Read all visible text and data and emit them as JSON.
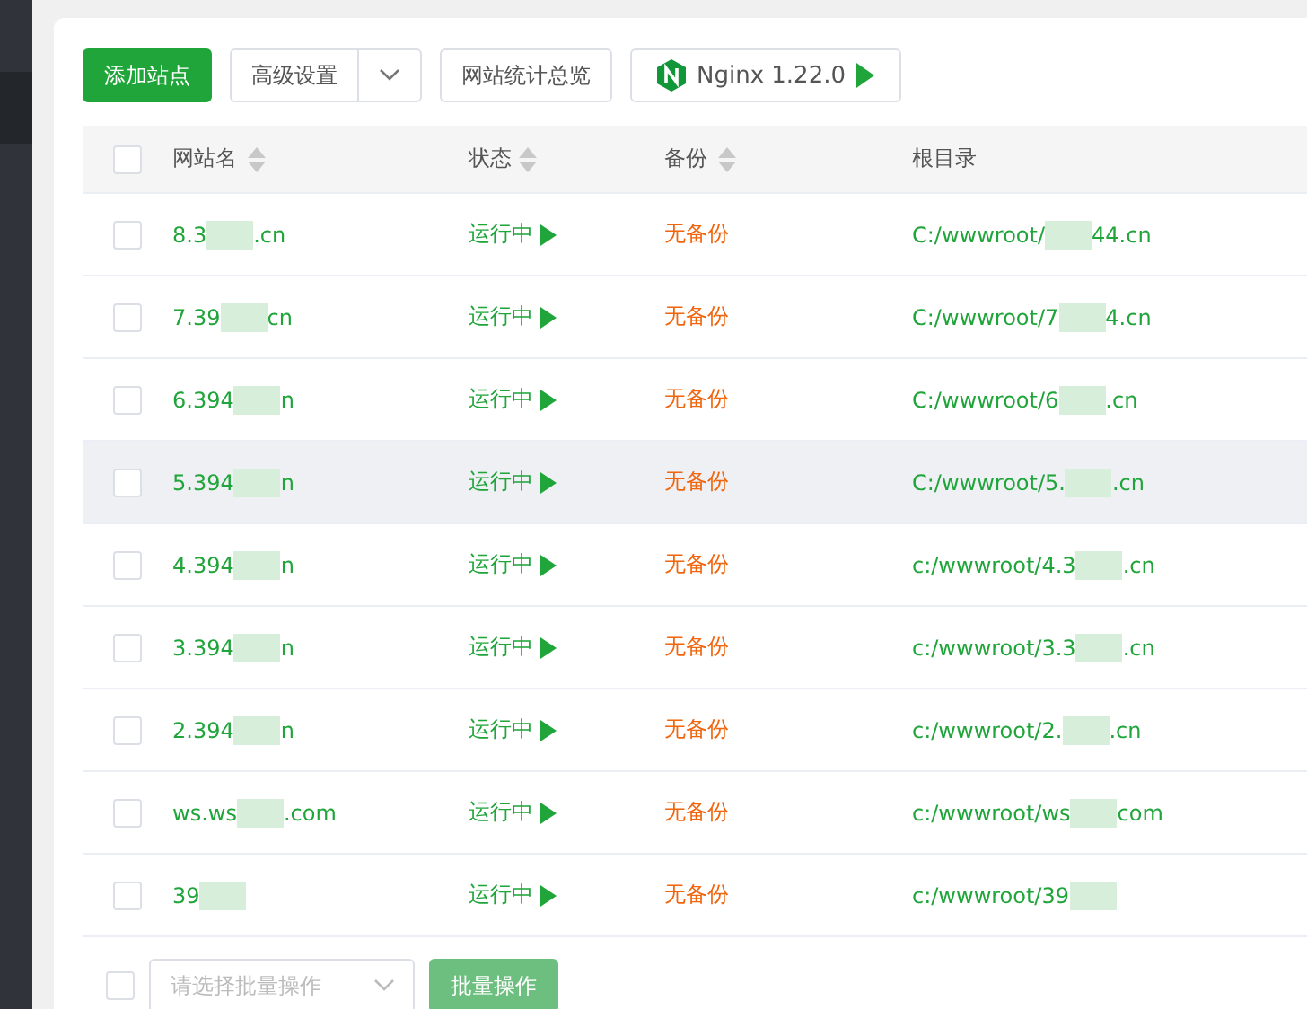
{
  "toolbar": {
    "add_button": "添加站点",
    "advanced_button": "高级设置",
    "stats_button": "网站统计总览",
    "server_button": "Nginx 1.22.0"
  },
  "table": {
    "select_all_checked": false,
    "columns": [
      "网站名",
      "状态",
      "备份",
      "根目录"
    ],
    "rows": [
      {
        "name_start": "8.3",
        "name_end": ".cn",
        "status": "运行中",
        "backup": "无备份",
        "root_start": "C:/wwwroot/",
        "root_end": "44.cn",
        "highlighted": false
      },
      {
        "name_start": "7.39",
        "name_end": "cn",
        "status": "运行中",
        "backup": "无备份",
        "root_start": "C:/wwwroot/7",
        "root_end": "4.cn",
        "highlighted": false
      },
      {
        "name_start": "6.394",
        "name_end": "n",
        "status": "运行中",
        "backup": "无备份",
        "root_start": "C:/wwwroot/6",
        "root_end": ".cn",
        "highlighted": false
      },
      {
        "name_start": "5.394",
        "name_end": "n",
        "status": "运行中",
        "backup": "无备份",
        "root_start": "C:/wwwroot/5.",
        "root_end": ".cn",
        "highlighted": true
      },
      {
        "name_start": "4.394",
        "name_end": "n",
        "status": "运行中",
        "backup": "无备份",
        "root_start": "c:/wwwroot/4.3",
        "root_end": ".cn",
        "highlighted": false
      },
      {
        "name_start": "3.394",
        "name_end": "n",
        "status": "运行中",
        "backup": "无备份",
        "root_start": "c:/wwwroot/3.3",
        "root_end": ".cn",
        "highlighted": false
      },
      {
        "name_start": "2.394",
        "name_end": "n",
        "status": "运行中",
        "backup": "无备份",
        "root_start": "c:/wwwroot/2.",
        "root_end": ".cn",
        "highlighted": false
      },
      {
        "name_start": "ws.ws",
        "name_end": ".com",
        "status": "运行中",
        "backup": "无备份",
        "root_start": "c:/wwwroot/ws",
        "root_end": "com",
        "highlighted": false
      },
      {
        "name_start": "39",
        "name_end": "",
        "status": "运行中",
        "backup": "无备份",
        "root_start": "c:/wwwroot/39",
        "root_end": "",
        "highlighted": false
      }
    ]
  },
  "footer": {
    "checked": false,
    "batch_select": {
      "placeholder": "请选择批量操作"
    },
    "batch_button": "批量操作"
  }
}
